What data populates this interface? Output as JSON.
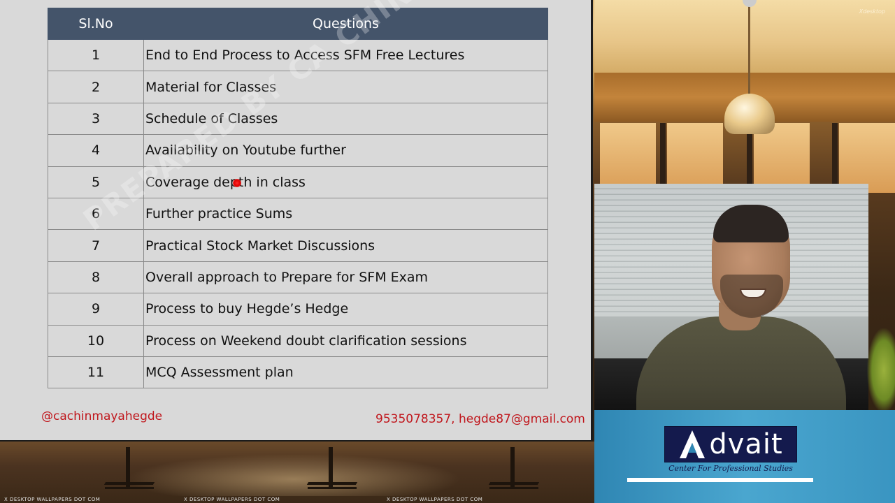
{
  "table": {
    "headers": {
      "sl": "Sl.No",
      "questions": "Questions"
    },
    "rows": [
      {
        "no": "1",
        "question": "End to End Process to Access SFM Free Lectures"
      },
      {
        "no": "2",
        "question": "Material for Classes"
      },
      {
        "no": "3",
        "question": "Schedule of Classes"
      },
      {
        "no": "4",
        "question": "Availability on Youtube further"
      },
      {
        "no": "5",
        "question": "Coverage depth in class"
      },
      {
        "no": "6",
        "question": "Further practice Sums"
      },
      {
        "no": "7",
        "question": "Practical Stock Market Discussions"
      },
      {
        "no": "8",
        "question": "Overall approach to Prepare for SFM Exam"
      },
      {
        "no": "9",
        "question": "Process to buy Hegde’s Hedge"
      },
      {
        "no": "10",
        "question": "Process on Weekend doubt clarification sessions"
      },
      {
        "no": "11",
        "question": "MCQ Assessment plan"
      }
    ]
  },
  "slide": {
    "watermark": "PREPARED BY CA CHINMAYA HEGDE",
    "handle": "@cachinmayahegde",
    "contact": "9535078357, hegde87@gmail.com"
  },
  "logo": {
    "mark_icon": "advait-a-mark-icon",
    "text": "dvait",
    "tagline": "Center For Professional Studies"
  },
  "background": {
    "top_watermark": "Xdesktop",
    "bottom_watermarks": [
      "X DESKTOP WALLPAPERS DOT COM",
      "X DESKTOP WALLPAPERS DOT COM",
      "X DESKTOP WALLPAPERS DOT COM"
    ]
  },
  "colors": {
    "header_bg": "#44546a",
    "slide_bg": "#d9d9d9",
    "contact_red": "#c0161c",
    "logo_navy": "#141a4d",
    "laser": "#e00000"
  }
}
